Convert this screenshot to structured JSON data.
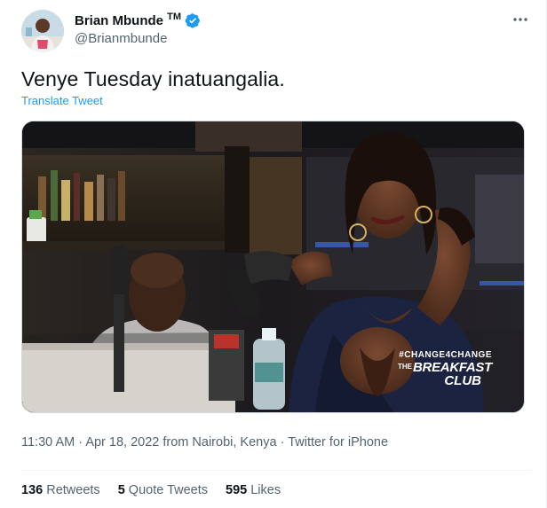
{
  "author": {
    "name": "Brian Mbunde",
    "trademark": "TM",
    "handle": "@Brianmbunde"
  },
  "more_icon": "more-icon",
  "tweet": {
    "text": "Venye Tuesday inatuangalia.",
    "translate_label": "Translate Tweet"
  },
  "media_overlay": {
    "hashtag": "#CHANGE4CHANGE",
    "show_prefix": "THE",
    "show_main": "BREAKFAST",
    "show_sub": "CLUB"
  },
  "meta": {
    "time": "11:30 AM",
    "separator": "·",
    "date": "Apr 18, 2022",
    "location": "from Nairobi, Kenya",
    "source": "Twitter for iPhone"
  },
  "stats": {
    "retweets_count": "136",
    "retweets_label": "Retweets",
    "quotes_count": "5",
    "quotes_label": "Quote Tweets",
    "likes_count": "595",
    "likes_label": "Likes"
  },
  "colors": {
    "link_blue": "#1d9bf0",
    "text_primary": "#0f1419",
    "text_secondary": "#536471",
    "border": "#eff3f4"
  }
}
